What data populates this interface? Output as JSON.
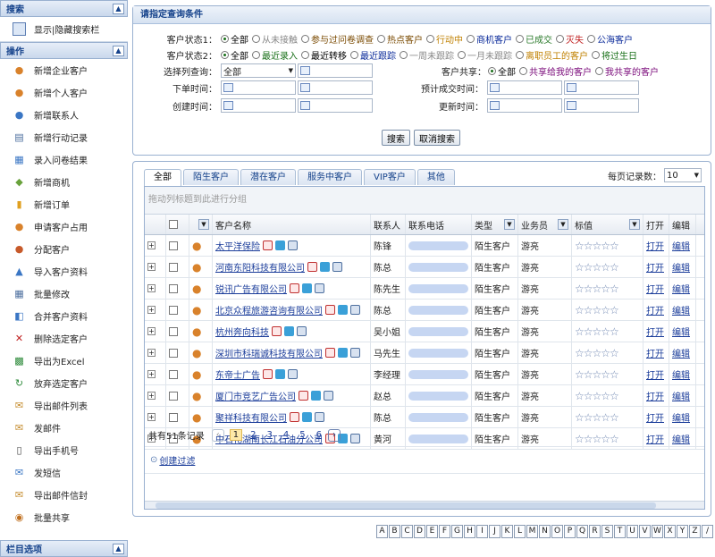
{
  "sidebar": {
    "search_title": "搜索",
    "toggle_label": "显示|隐藏搜索栏",
    "ops_title": "操作",
    "items": [
      "新增企业客户",
      "新增个人客户",
      "新增联系人",
      "新增行动记录",
      "录入问卷结果",
      "新增商机",
      "新增订单",
      "申请客户占用",
      "分配客户",
      "导入客户资料",
      "批量修改",
      "合并客户资料",
      "删除选定客户",
      "导出为Excel",
      "放弃选定客户",
      "导出邮件列表",
      "发邮件",
      "导出手机号",
      "发短信",
      "导出邮件信封",
      "批量共享"
    ],
    "icons": [
      "person-icon",
      "person-icon",
      "contact-icon",
      "document-icon",
      "form-icon",
      "deal-icon",
      "chart-icon",
      "person-icon",
      "users-icon",
      "import-icon",
      "table-icon",
      "merge-icon",
      "delete-icon",
      "excel-icon",
      "refresh-icon",
      "mail-icon",
      "mail-icon",
      "phone-icon",
      "sms-icon",
      "envelope-icon",
      "share-icon"
    ],
    "bottom_title": "栏目选项"
  },
  "query": {
    "title": "请指定查询条件",
    "status1_label": "客户状态1：",
    "status1_options": [
      "全部",
      "从未接触",
      "参与过问卷调查",
      "热点客户",
      "行动中",
      "商机客户",
      "已成交",
      "灭失",
      "公海客户"
    ],
    "status2_label": "客户状态2：",
    "status2_options": [
      "全部",
      "最近录入",
      "最近转移",
      "最近跟踪",
      "一周未跟踪",
      "一月未跟踪",
      "离职员工的客户",
      "将过生日"
    ],
    "column_label": "选择列查询：",
    "column_value": "全部",
    "order_time_label": "下单时间：",
    "create_time_label": "创建时间：",
    "share_label": "客户共享：",
    "share_options": [
      "全部",
      "共享给我的客户",
      "我共享的客户"
    ],
    "deal_time_label": "预计成交时间：",
    "update_time_label": "更新时间：",
    "search_btn": "搜索",
    "cancel_btn": "取消搜索"
  },
  "grid": {
    "tabs": [
      "全部",
      "陌生客户",
      "潜在客户",
      "服务中客户",
      "VIP客户",
      "其他"
    ],
    "per_page_label": "每页记录数：",
    "per_page_value": "10",
    "group_hint": "拖动列标题到此进行分组",
    "headers": [
      "客户名称",
      "联系人",
      "联系电话",
      "类型",
      "业务员",
      "标值",
      "打开",
      "编辑"
    ],
    "rows": [
      {
        "name": "太平洋保险",
        "contact": "陈锋",
        "type": "陌生客户",
        "staff": "游亮",
        "open": "打开",
        "edit": "编辑"
      },
      {
        "name": "河南东阳科技有限公司",
        "contact": "陈总",
        "type": "陌生客户",
        "staff": "游亮",
        "open": "打开",
        "edit": "编辑"
      },
      {
        "name": "锐讯广告有限公司",
        "contact": "陈先生",
        "type": "陌生客户",
        "staff": "游亮",
        "open": "打开",
        "edit": "编辑"
      },
      {
        "name": "北京众程旅游咨询有限公司",
        "contact": "陈总",
        "type": "陌生客户",
        "staff": "游亮",
        "open": "打开",
        "edit": "编辑"
      },
      {
        "name": "杭州奔向科技",
        "contact": "吴小姐",
        "type": "陌生客户",
        "staff": "游亮",
        "open": "打开",
        "edit": "编辑"
      },
      {
        "name": "深圳市科瑞诚科技有限公司",
        "contact": "马先生",
        "type": "陌生客户",
        "staff": "游亮",
        "open": "打开",
        "edit": "编辑"
      },
      {
        "name": "东帝士广告",
        "contact": "李经理",
        "type": "陌生客户",
        "staff": "游亮",
        "open": "打开",
        "edit": "编辑"
      },
      {
        "name": "厦门市竞艺广告公司",
        "contact": "赵总",
        "type": "陌生客户",
        "staff": "游亮",
        "open": "打开",
        "edit": "编辑"
      },
      {
        "name": "聚祥科技有限公司",
        "contact": "陈总",
        "type": "陌生客户",
        "staff": "游亮",
        "open": "打开",
        "edit": "编辑"
      },
      {
        "name": "中石化湖南长江石油分公司",
        "contact": "黄河",
        "type": "陌生客户",
        "staff": "游亮",
        "open": "打开",
        "edit": "编辑"
      }
    ],
    "total": "共有51条记录",
    "pages": [
      "1",
      "2",
      "3",
      "4",
      "5",
      "6"
    ],
    "create_filter": "创建过滤"
  },
  "alphabet": [
    "A",
    "B",
    "C",
    "D",
    "E",
    "F",
    "G",
    "H",
    "I",
    "J",
    "K",
    "L",
    "M",
    "N",
    "O",
    "P",
    "Q",
    "R",
    "S",
    "T",
    "U",
    "V",
    "W",
    "X",
    "Y",
    "Z",
    "/"
  ]
}
